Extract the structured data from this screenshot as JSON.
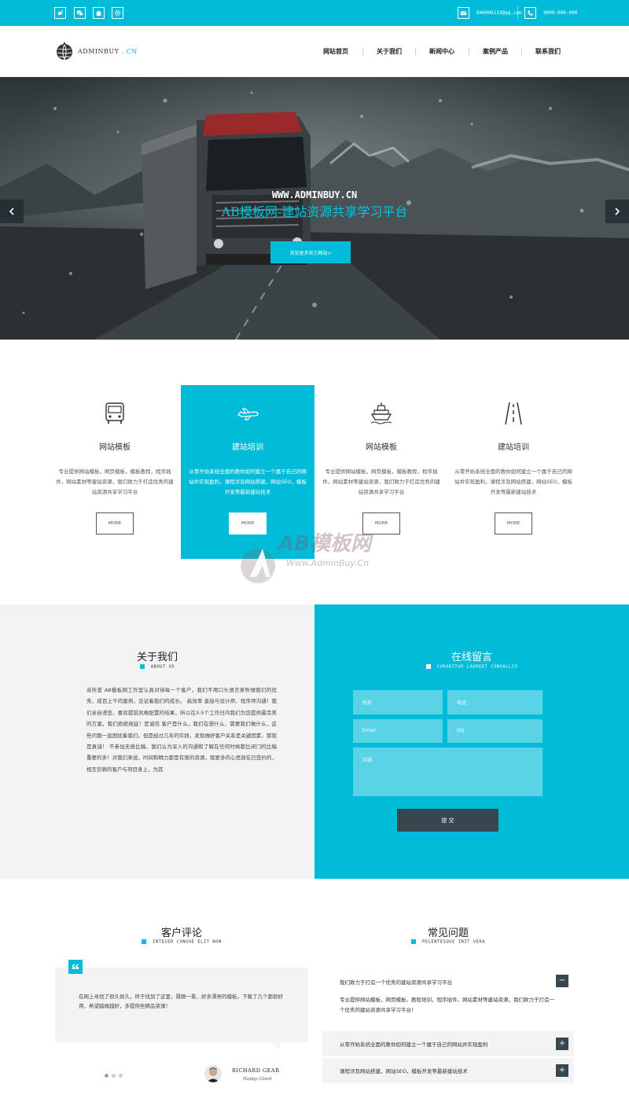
{
  "topbar": {
    "icons": [
      "weibo-icon",
      "wechat-icon",
      "home-icon",
      "settings-icon"
    ],
    "email": "646006133@qq.com",
    "phone": "4000-000-000"
  },
  "header": {
    "logo_text": "ADMINBUY",
    "logo_suffix": ". CN",
    "nav": [
      "网站首页",
      "关于我们",
      "新闻中心",
      "案例产品",
      "联系我们"
    ]
  },
  "hero": {
    "url": "WWW.ADMINBUY.CN",
    "title": "AB模板网-建站资源共享学习平台",
    "button": "浏览更多官方网站>"
  },
  "features": [
    {
      "title": "网站模板",
      "desc": "专业提供网站模板，网页模板，模板教程，程序插件，网站素材等建站资源，我们致力于打造优秀的建站资源共享学习平台",
      "button": "MORE",
      "icon": "bus-icon"
    },
    {
      "title": "建站培训",
      "desc": "从零开始系统全面的教你如何建立一个属于自己的网站并实现盈利，课程涉及网站搭建，网站SEO，模板开发等最新建站技术",
      "button": "MORE",
      "icon": "airplane-icon"
    },
    {
      "title": "网站模板",
      "desc": "专业提供网站模板，网页模板，模板教程，程序插件，网站素材等建站资源，我们致力于打造优秀的建站资源共享学习平台",
      "button": "MORE",
      "icon": "ship-icon"
    },
    {
      "title": "建站培训",
      "desc": "从零开始系统全面的教你如何建立一个属于自己的网站并实现盈利，课程涉及网站搭建，网站SEO，模板开发等最新建站技术",
      "button": "MORE",
      "icon": "road-icon"
    }
  ],
  "watermark": {
    "brand": "AB模板网",
    "url": "Www.AdminBuy.Cn"
  },
  "about": {
    "title": "关于我们",
    "subtitle": "ABOUT US",
    "text": "亲所爱 AB模板网工作室认真对待每一个客户，我们不用口头语言来吹嘘我们的优秀，成百上千的案例，见证着我们的成长。 高效率 直接与设计师、程序师沟通！我们亲自递签，喜欢提前风格配置的结果，所以在3-5个工作日内我们为您提供最完美的方案，我们拒绝拖延！是诚信 客户是什么，我们在想什么，需要我们做什么，这些问题一直困扰着我们。但是经过几年的实践，发现做好客户关系是关键因素，那就是真诚！ 不参加无偿比稿，我们认为深入的沟通和了解在任何时候都比闭门的比稿重要的多！对我们来说，时间和精力都是有限的资源，我更多的心思放在已签约的，相互信赖的客户与项目身上，为其"
  },
  "contact": {
    "title": "在线留言",
    "subtitle": "CURABITUR LAOREET CONVALLIS",
    "fields": [
      "姓名",
      "电话",
      "Email",
      "QQ",
      "内容"
    ],
    "submit": "提 交"
  },
  "reviews": {
    "title": "客户评论",
    "subtitle": "INTEGER CONGUE ELIT NON",
    "quote": "在网上寻找了很久很久，终于找到了这里，晃眼一看，好多漂亮的模板，下载了几个都很好用，希望越做越好，多提供些精品资源！",
    "author": "RICHARD GEAR",
    "role": "Happy Client"
  },
  "faq": {
    "title": "常见问题",
    "subtitle": "PELENTESQUE INIT VERA",
    "items": [
      {
        "q": "我们致力于打造一个优秀的建站资源共享学习平台",
        "a": "专业提供网站模板，网页模板，教程培训，程序插件，网站素材等建站资源，我们致力于打造一个优秀的建站资源共享学习平台！",
        "toggle": "−"
      },
      {
        "q": "从零开始系统全面的教你如何建立一个属于自己的网站并实现盈利",
        "toggle": "+"
      },
      {
        "q": "课程涉及网站搭建，网站SEO，模板开发等最新建站技术",
        "toggle": "+"
      }
    ]
  },
  "colors": {
    "accent": "#00bcd8",
    "dark": "#37474f",
    "light_bg": "#f3f3f3"
  }
}
